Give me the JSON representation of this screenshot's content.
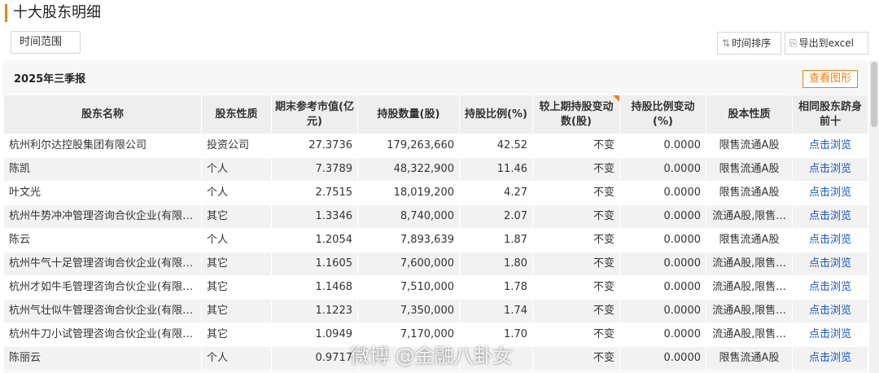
{
  "title": "十大股东明细",
  "toolbar": {
    "range_label": "时间范围",
    "sort_label": "时间排序",
    "export_label": "导出到excel"
  },
  "quarter": "2025年三季报",
  "view_chart": "查看图形",
  "columns": [
    "股东名称",
    "股东性质",
    "期末参考市值(亿元)",
    "持股数量(股)",
    "持股比例(%)",
    "较上期持股变动数(股)",
    "持股比例变动(%)",
    "股本性质",
    "相同股东跻身前十"
  ],
  "rows": [
    {
      "name": "杭州利尔达控股集团有限公司",
      "type": "投资公司",
      "value": "27.3736",
      "shares": "179,263,660",
      "ratio": "42.52",
      "change": "不变",
      "ratio_change": "0.0000",
      "nature": "限售流通A股",
      "link": "点击浏览"
    },
    {
      "name": "陈凯",
      "type": "个人",
      "value": "7.3789",
      "shares": "48,322,900",
      "ratio": "11.46",
      "change": "不变",
      "ratio_change": "0.0000",
      "nature": "限售流通A股",
      "link": "点击浏览"
    },
    {
      "name": "叶文光",
      "type": "个人",
      "value": "2.7515",
      "shares": "18,019,200",
      "ratio": "4.27",
      "change": "不变",
      "ratio_change": "0.0000",
      "nature": "限售流通A股",
      "link": "点击浏览"
    },
    {
      "name": "杭州牛势冲冲管理咨询合伙企业(有限合...",
      "type": "其它",
      "value": "1.3346",
      "shares": "8,740,000",
      "ratio": "2.07",
      "change": "不变",
      "ratio_change": "0.0000",
      "nature": "流通A股,限售...",
      "link": "点击浏览"
    },
    {
      "name": "陈云",
      "type": "个人",
      "value": "1.2054",
      "shares": "7,893,639",
      "ratio": "1.87",
      "change": "不变",
      "ratio_change": "0.0000",
      "nature": "限售流通A股",
      "link": "点击浏览"
    },
    {
      "name": "杭州牛气十足管理咨询合伙企业(有限合...",
      "type": "其它",
      "value": "1.1605",
      "shares": "7,600,000",
      "ratio": "1.80",
      "change": "不变",
      "ratio_change": "0.0000",
      "nature": "流通A股,限售...",
      "link": "点击浏览"
    },
    {
      "name": "杭州才如牛毛管理咨询合伙企业(有限合...",
      "type": "其它",
      "value": "1.1468",
      "shares": "7,510,000",
      "ratio": "1.78",
      "change": "不变",
      "ratio_change": "0.0000",
      "nature": "流通A股,限售...",
      "link": "点击浏览"
    },
    {
      "name": "杭州气壮似牛管理咨询合伙企业(有限合...",
      "type": "其它",
      "value": "1.1223",
      "shares": "7,350,000",
      "ratio": "1.74",
      "change": "不变",
      "ratio_change": "0.0000",
      "nature": "流通A股,限售...",
      "link": "点击浏览"
    },
    {
      "name": "杭州牛刀小试管理咨询合伙企业(有限合...",
      "type": "其它",
      "value": "1.0949",
      "shares": "7,170,000",
      "ratio": "1.70",
      "change": "不变",
      "ratio_change": "0.0000",
      "nature": "流通A股,限售...",
      "link": "点击浏览"
    },
    {
      "name": "陈丽云",
      "type": "个人",
      "value": "0.9717",
      "shares": "",
      "ratio": "",
      "change": "不变",
      "ratio_change": "0.0000",
      "nature": "限售流通A股",
      "link": "点击浏览"
    }
  ],
  "watermark": "微博 @金融八卦女",
  "colors": {
    "accent": "#ef7f1a",
    "link": "#1a56c8",
    "header_bg": "#eeeeee"
  },
  "icons": {
    "sort": "sort-arrows-icon",
    "export": "export-icon"
  }
}
